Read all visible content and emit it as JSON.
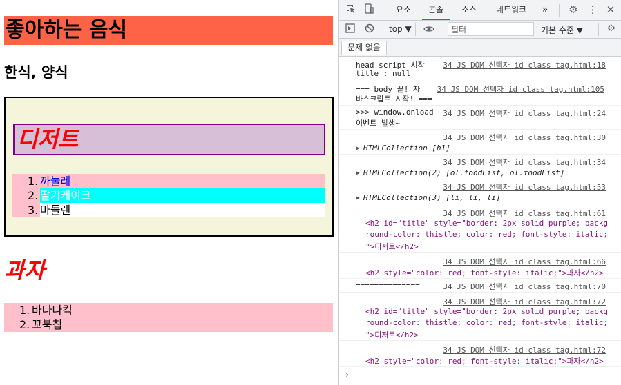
{
  "page": {
    "h1": "좋아하는 음식",
    "subtitle": "한식, 양식",
    "dessert_title": "디저트",
    "food_list": [
      {
        "num": "1.",
        "label": "까눌레"
      },
      {
        "num": "2.",
        "label": "딸기케이크"
      },
      {
        "num": "3.",
        "label": "마들렌"
      }
    ],
    "snack_title": "과자",
    "snack_list": [
      {
        "num": "1.",
        "label": "바나나킥"
      },
      {
        "num": "2.",
        "label": "꼬북칩"
      }
    ]
  },
  "devtools": {
    "tabs": [
      "요소",
      "콘솔",
      "소스",
      "네트워크"
    ],
    "more": "»",
    "context": "top ▼",
    "filter_placeholder": "필터",
    "level": "기본 수준 ▼",
    "issues": "문제 없음",
    "messages": [
      {
        "text1": "head script 시작",
        "text2": "title : null",
        "src": "34 JS DOM 선택자 id class tag.html:18"
      },
      {
        "text1": "=== body 끝! 자",
        "text2": "바스크립트 시작! ===",
        "src": "34 JS DOM 선택자 id class tag.html:105"
      },
      {
        "text1": ">>> window.onload",
        "text2": "이벤트 발생~",
        "src": "34 JS DOM 선택자 id class tag.html:24"
      },
      {
        "src": "34 JS DOM 선택자 id class tag.html:30",
        "obj": "HTMLCollection [h1]"
      },
      {
        "src": "34 JS DOM 선택자 id class tag.html:34",
        "obj": "HTMLCollection(2) [ol.foodList, ol.foodList]"
      },
      {
        "src": "34 JS DOM 선택자 id class tag.html:53",
        "obj": "HTMLCollection(3) [li, li, li]"
      },
      {
        "src": "34 JS DOM 선택자 id class tag.html:61",
        "l1": "<h2 id=\"title\" style=\"border: 2px solid purple; backg",
        "l2": "round-color: thistle; color: red; font-style: italic;",
        "l3": "\">디저트</h2>"
      },
      {
        "src": "34 JS DOM 선택자 id class tag.html:66",
        "l1": "<h2 style=\"color: red; font-style: italic;\">과자</h2>"
      },
      {
        "text1": "==============",
        "src": "34 JS DOM 선택자 id class tag.html:70"
      },
      {
        "src": "34 JS DOM 선택자 id class tag.html:72",
        "l1": "<h2 id=\"title\" style=\"border: 2px solid purple; backg",
        "l2": "round-color: thistle; color: red; font-style: italic;",
        "l3": "\">디저트</h2>"
      },
      {
        "src": "34 JS DOM 선택자 id class tag.html:72",
        "l1": "<h2 style=\"color: red; font-style: italic;\">과자</h2>"
      }
    ],
    "prompt": "›"
  }
}
